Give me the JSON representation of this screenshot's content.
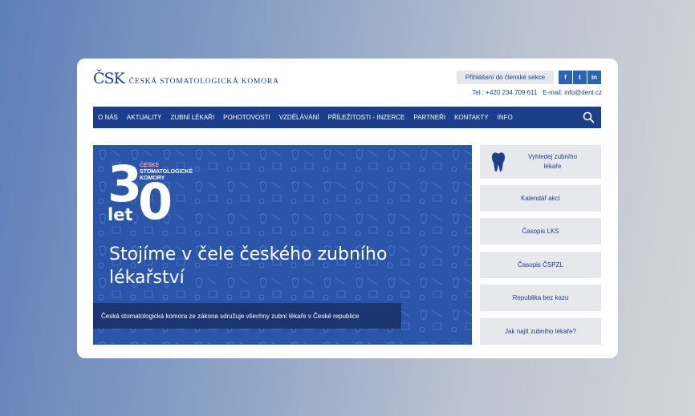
{
  "header": {
    "logo_mark": "ČSK",
    "logo_text": "Česká stomatologická komora",
    "login_label": "Přihlášení do členské sekce",
    "social": [
      "f",
      "t",
      "in"
    ],
    "contact": "Tel.: +420 234 709 611   E-mail: info@dent.cz"
  },
  "nav": {
    "items": [
      "O NÁS",
      "AKTUALITY",
      "ZUBNÍ LÉKAŘI",
      "POHOTOVOSTI",
      "VZDĚLÁVÁNÍ",
      "PŘÍLEŽITOSTI - INZERCE",
      "PARTNEŘI",
      "KONTAKTY",
      "INFO"
    ],
    "search_icon": "search-icon"
  },
  "hero": {
    "badge_number_3": "3",
    "badge_number_0": "0",
    "badge_let": "let",
    "badge_small_1": "ČESKÉ",
    "badge_small_2": "STOMATOLOGICKÉ",
    "badge_small_3": "KOMORY",
    "title": "Stojíme v čele českého zubního lékařství",
    "caption": "Česká stomatologická komora ze zákona sdružuje všechny zubní lékaře v České republice",
    "background_color": "#2a55a8"
  },
  "sidebar": {
    "items": [
      "Vyhledej zubního lékaře",
      "Kalendář akcí",
      "Časopis LKS",
      "Časopis ČSPZL",
      "Republika bez kazu",
      "Jak najít zubního lékaře?"
    ],
    "first_icon": "tooth-icon"
  },
  "colors": {
    "brand": "#1c3f8c",
    "button_bg": "#e6e8ec",
    "social": "#2a64b8"
  }
}
